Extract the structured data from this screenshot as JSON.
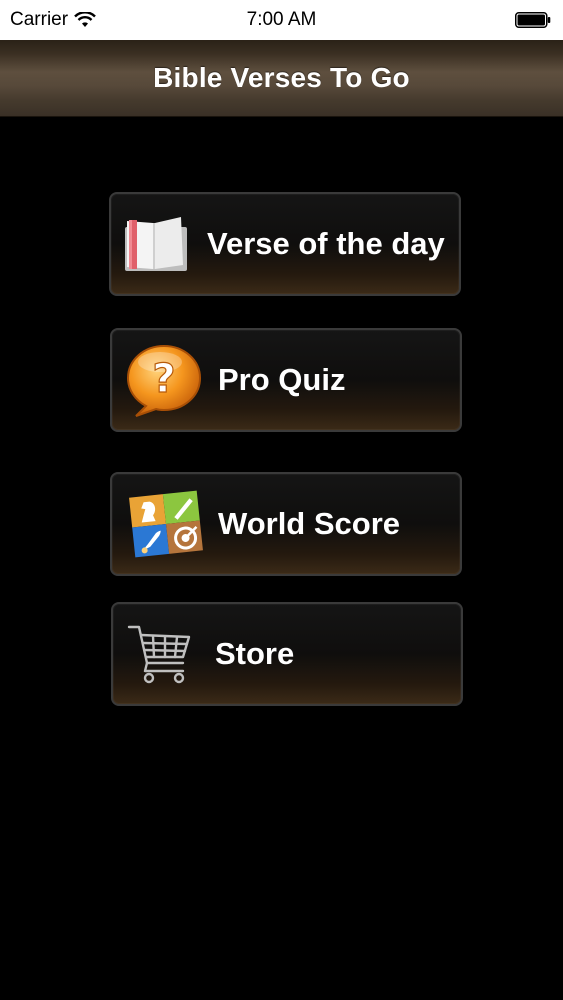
{
  "status_bar": {
    "carrier": "Carrier",
    "time": "7:00 AM",
    "icons": [
      "wifi-icon",
      "battery-icon"
    ]
  },
  "nav": {
    "title": "Bible Verses To Go"
  },
  "menu": {
    "items": [
      {
        "label": "Verse of the day",
        "icon": "book-icon"
      },
      {
        "label": "Pro Quiz",
        "icon": "question-bubble-icon"
      },
      {
        "label": "World Score",
        "icon": "game-center-icon"
      },
      {
        "label": "Store",
        "icon": "shopping-cart-icon"
      }
    ]
  },
  "colors": {
    "background": "#000000",
    "nav_bar": "#5e4f3e",
    "button_border": "#3a3a3a",
    "quiz_orange": "#f08a1c",
    "book_ribbon": "#e0606a"
  }
}
